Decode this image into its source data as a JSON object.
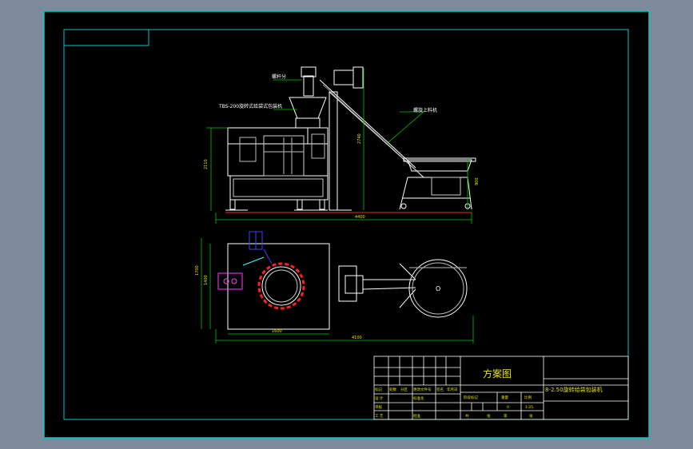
{
  "colors": {
    "background": "#7c8a9b",
    "canvas": "#000000",
    "frame": "#00c8c8",
    "line": "#ffffff",
    "text": "#e6e600",
    "dimension": "#00c800",
    "ground": "#ff2020",
    "chamber": "#ff2020",
    "component_blue": "#4040ff",
    "component_magenta": "#ff40ff",
    "component_cyan": "#40ffff"
  },
  "labels": {
    "screw_feeder": "螺杆分",
    "machine_model": "TBS-200旋转式给袋式包装机",
    "conveyor": "螺旋上料机"
  },
  "dimensions": {
    "front_height_left": "2110",
    "hopper_height": "2740",
    "conveyor_height": "900",
    "front_width": "4400",
    "plan_height_outer": "1700",
    "plan_height_inner": "1400",
    "plan_width_inner": "1600",
    "plan_width_outer": "4100",
    "tank_label": "O"
  },
  "title_block": {
    "drawing_title": "方案图",
    "product_name": "8-2.50旋转给袋包装机",
    "row_header": [
      "标记",
      "处数",
      "分区",
      "更改文件号",
      "签名",
      "年月日"
    ],
    "design_label": "设 计",
    "standardize_label": "标准化",
    "check_label": "审核",
    "process_label": "工 艺",
    "approve_label": "批准",
    "stage_label": "阶段标记",
    "weight_label": "重量",
    "scale_label": "比例",
    "weight_value": "0",
    "scale_value": "1:25",
    "sheets_total_label": "共",
    "sheets_label": "张",
    "sheet_no_label": "第",
    "sheet_no_suffix": "张"
  }
}
